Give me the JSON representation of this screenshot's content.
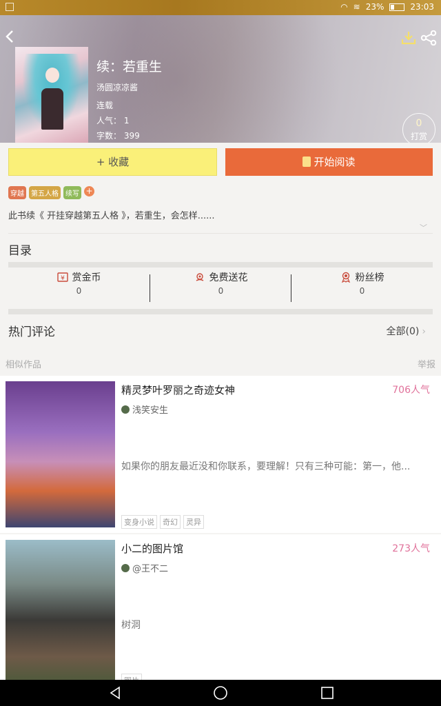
{
  "status_bar": {
    "battery": "23%",
    "time": "23:03"
  },
  "book": {
    "title": "续：若重生",
    "author": "汤圆凉凉酱",
    "status": "连载",
    "popularity": "人气： 1",
    "word_count": "字数： 399",
    "tip_count": "0",
    "tip_label": "打赏"
  },
  "actions": {
    "favorite": "+ 收藏",
    "read": "开始阅读"
  },
  "tags": [
    "穿越",
    "第五人格",
    "续写"
  ],
  "tag_add": "+",
  "synopsis": "此书续《 开挂穿越第五人格 》，若重生，会怎样......",
  "catalog_label": "目录",
  "stats": [
    {
      "label": "赏金币",
      "value": "0"
    },
    {
      "label": "免费送花",
      "value": "0"
    },
    {
      "label": "粉丝榜",
      "value": "0"
    }
  ],
  "comments": {
    "label": "热门评论",
    "all": "全部(0)"
  },
  "similar_label": "相似作品",
  "report_label": "举报",
  "similar_works": [
    {
      "title": "精灵梦叶罗丽之奇迹女神",
      "popularity": "706人气",
      "author": "浅笑安生",
      "description": "如果你的朋友最近没和你联系，要理解！只有三种可能：第一，他...",
      "tags": [
        "变身小说",
        "奇幻",
        "灵异"
      ]
    },
    {
      "title": "小二的图片馆",
      "popularity": "273人气",
      "author": "@王不二",
      "description": "树洞",
      "tags": [
        "图片"
      ]
    }
  ],
  "colors": {
    "accent_orange": "#e96a3a",
    "fav_yellow": "#faf079",
    "pop_pink": "#e0719a"
  }
}
